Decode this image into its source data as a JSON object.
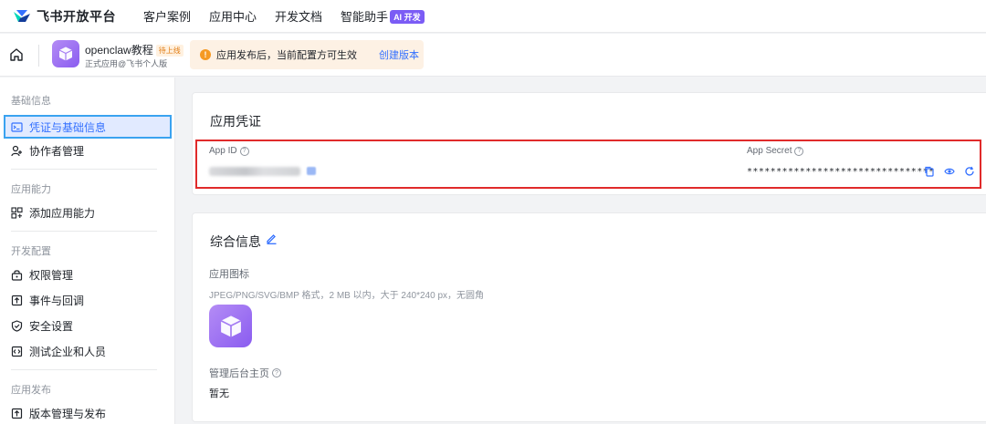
{
  "topnav": {
    "brand": "飞书开放平台",
    "links": [
      "客户案例",
      "应用中心",
      "开发文档",
      "智能助手"
    ],
    "ai_badge": "AI 开发"
  },
  "app": {
    "name": "openclaw教程",
    "status": "待上线",
    "subtitle": "正式应用@飞书个人版",
    "notice_text": "应用发布后，当前配置方可生效",
    "notice_link": "创建版本"
  },
  "sidebar": {
    "sections": [
      {
        "title": "基础信息",
        "items": [
          {
            "label": "凭证与基础信息",
            "icon": "credential-icon"
          },
          {
            "label": "协作者管理",
            "icon": "user-add-icon"
          }
        ]
      },
      {
        "title": "应用能力",
        "items": [
          {
            "label": "添加应用能力",
            "icon": "grid-add-icon"
          }
        ]
      },
      {
        "title": "开发配置",
        "items": [
          {
            "label": "权限管理",
            "icon": "lock-icon"
          },
          {
            "label": "事件与回调",
            "icon": "event-icon"
          },
          {
            "label": "安全设置",
            "icon": "shield-icon"
          },
          {
            "label": "测试企业和人员",
            "icon": "code-icon"
          }
        ]
      },
      {
        "title": "应用发布",
        "items": [
          {
            "label": "版本管理与发布",
            "icon": "upload-icon"
          }
        ]
      }
    ]
  },
  "credentials": {
    "title": "应用凭证",
    "app_id_label": "App ID",
    "app_secret_label": "App Secret",
    "app_secret_value": "********************************"
  },
  "general": {
    "title": "综合信息",
    "icon_label": "应用图标",
    "icon_hint": "JPEG/PNG/SVG/BMP 格式，2 MB 以内，大于 240*240 px，无圆角",
    "homepage_label": "管理后台主页",
    "homepage_value": "暂无"
  },
  "colors": {
    "accent": "#3370ff",
    "highlight_border": "#e02a2a",
    "active_border": "#3aa3f0",
    "app_icon": "#8a5cf0"
  }
}
